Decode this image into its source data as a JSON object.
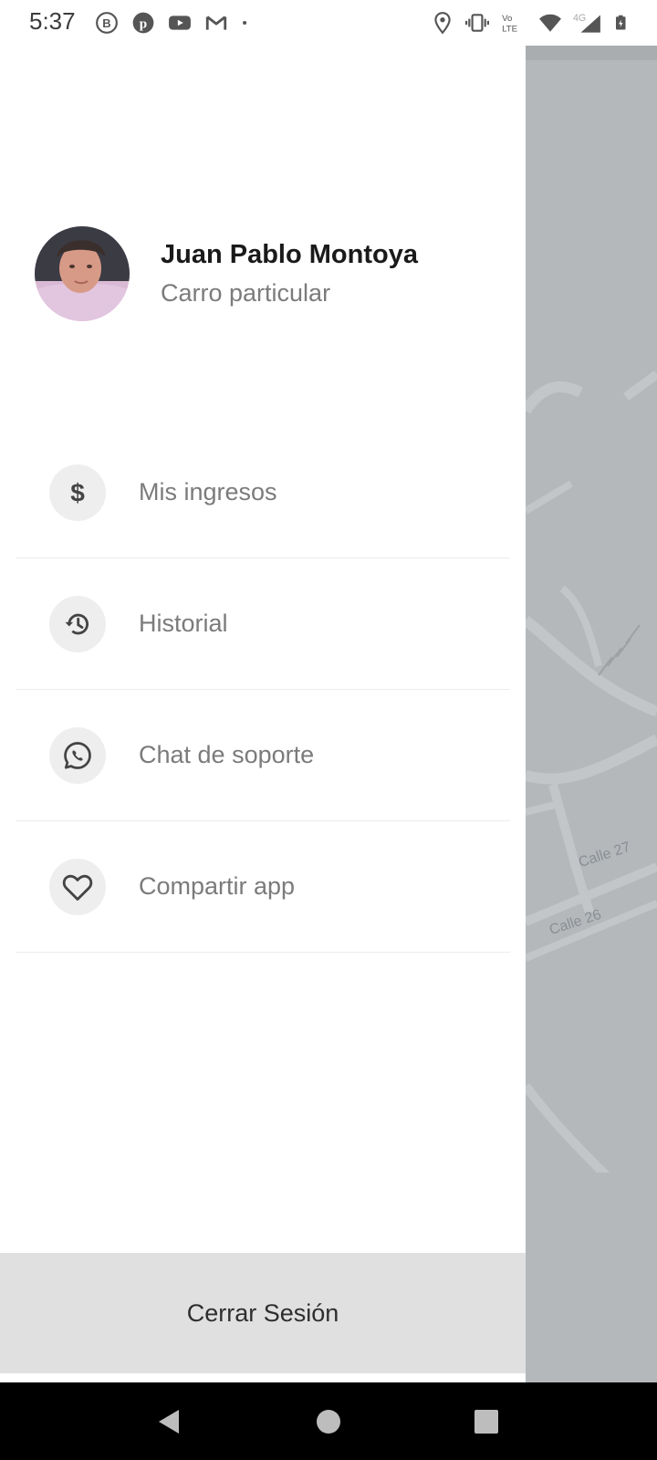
{
  "status_bar": {
    "time": "5:37",
    "left_icons": [
      "b-circle-icon",
      "pinterest-icon",
      "youtube-icon",
      "gmail-icon",
      "dot-icon"
    ],
    "right_icons": [
      "location-icon",
      "vibrate-icon",
      "volte-icon",
      "wifi-icon",
      "4g-signal-icon",
      "battery-charging-icon"
    ],
    "volte_label": "Vo LTE",
    "network_label": "4G"
  },
  "profile": {
    "name": "Juan Pablo Montoya",
    "subtitle": "Carro particular"
  },
  "menu": {
    "items": [
      {
        "label": "Mis ingresos",
        "icon": "dollar-icon"
      },
      {
        "label": "Historial",
        "icon": "history-icon"
      },
      {
        "label": "Chat de soporte",
        "icon": "whatsapp-icon"
      },
      {
        "label": "Compartir app",
        "icon": "heart-icon"
      }
    ]
  },
  "logout": {
    "label": "Cerrar Sesión"
  },
  "map": {
    "street_labels": [
      "Calle 27",
      "Calle 26"
    ]
  },
  "nav_bar": {
    "buttons": [
      "back-icon",
      "home-icon",
      "recents-icon"
    ]
  },
  "colors": {
    "drawer_bg": "#ffffff",
    "map_overlay": "#b4b8bb",
    "logout_bg": "#e0e0e0",
    "icon_circle_bg": "#eeeeee",
    "text_muted": "#7b7b7b",
    "text_primary": "#1a1a1a"
  }
}
